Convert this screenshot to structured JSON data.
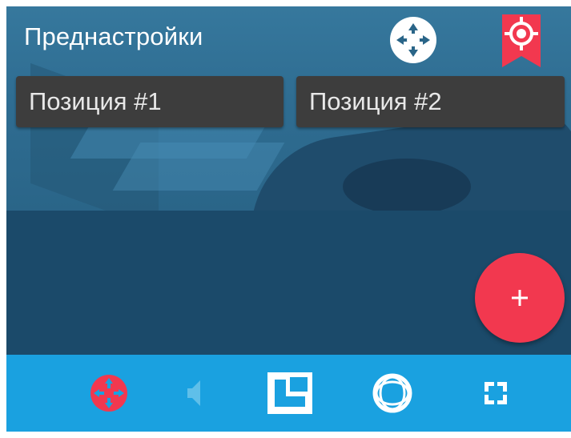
{
  "header": {
    "title": "Преднастройки"
  },
  "presets": [
    {
      "label": "Позиция #1"
    },
    {
      "label": "Позиция #2"
    }
  ],
  "fab": {
    "label": "+"
  },
  "bottom_bar": {
    "items": [
      {
        "icon": "ptz-icon",
        "active": true
      },
      {
        "icon": "sound-icon",
        "disabled": true
      },
      {
        "icon": "layout-icon"
      },
      {
        "icon": "fisheye-icon"
      },
      {
        "icon": "fullscreen-icon"
      }
    ]
  },
  "colors": {
    "accent": "#f2384f",
    "bottom_bar": "#1aa1e0",
    "preset_bg": "#3d3d3d",
    "overlay": "#1b4a6a"
  }
}
